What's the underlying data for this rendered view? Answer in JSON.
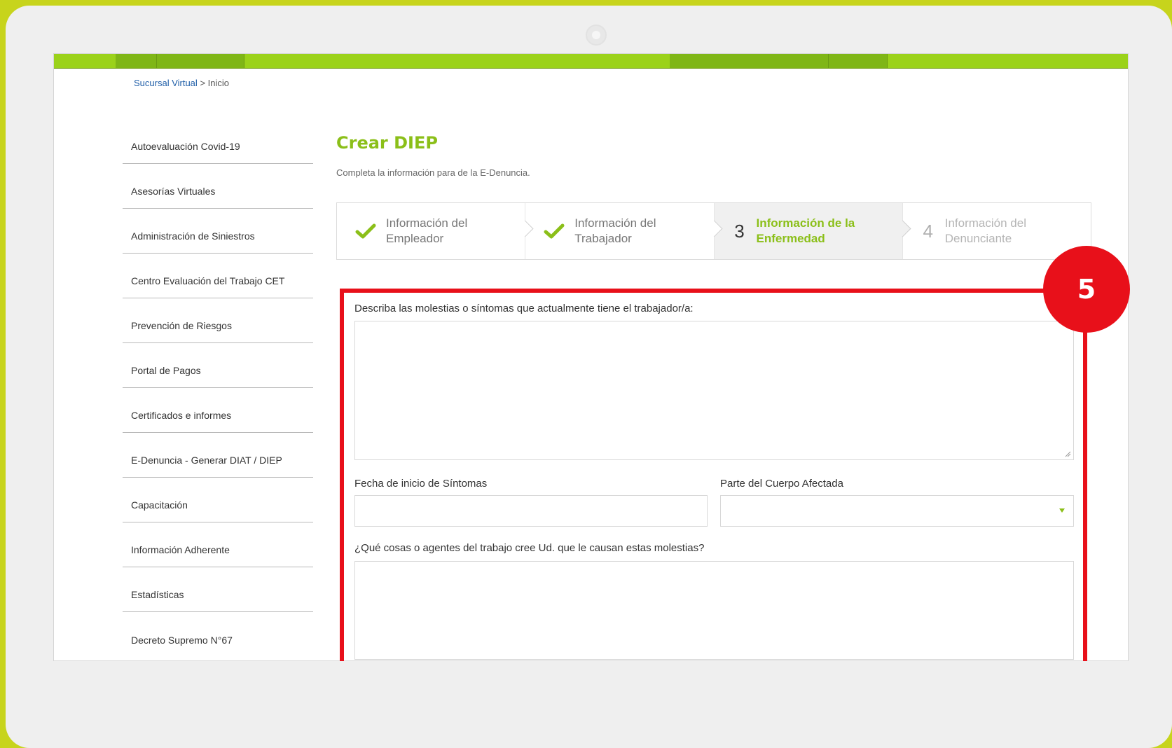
{
  "breadcrumb": {
    "home": "Sucursal Virtual",
    "separator": ">",
    "current": "Inicio"
  },
  "sidebar": {
    "items": [
      {
        "label": "Autoevaluación Covid-19"
      },
      {
        "label": "Asesorías Virtuales"
      },
      {
        "label": "Administración de Siniestros"
      },
      {
        "label": "Centro Evaluación del Trabajo CET"
      },
      {
        "label": "Prevención de Riesgos"
      },
      {
        "label": "Portal de Pagos"
      },
      {
        "label": "Certificados e informes"
      },
      {
        "label": "E-Denuncia - Generar DIAT / DIEP"
      },
      {
        "label": "Capacitación"
      },
      {
        "label": "Información Adherente"
      },
      {
        "label": "Estadísticas"
      },
      {
        "label": "Decreto Supremo N°67"
      }
    ]
  },
  "main": {
    "title": "Crear DIEP",
    "subtitle": "Completa la información para de la E-Denuncia.",
    "steps": [
      {
        "line1": "Información del",
        "line2": "Empleador",
        "status": "done"
      },
      {
        "line1": "Información del",
        "line2": "Trabajador",
        "status": "done"
      },
      {
        "number": "3",
        "line1": "Información de la",
        "line2": "Enfermedad",
        "status": "active"
      },
      {
        "number": "4",
        "line1": "Información del",
        "line2": "Denunciante",
        "status": "pending"
      }
    ]
  },
  "form": {
    "symptoms_label": "Describa las molestias o síntomas que actualmente tiene el trabajador/a:",
    "symptoms_value": "",
    "start_date_label": "Fecha de inicio de Síntomas",
    "start_date_value": "",
    "body_part_label": "Parte del Cuerpo Afectada",
    "body_part_value": "",
    "agents_label": "¿Qué cosas o agentes del trabajo cree Ud. que le causan estas molestias?",
    "agents_value": ""
  },
  "annotation": {
    "badge": "5",
    "color": "#e8101a"
  },
  "colors": {
    "accent": "#8bbf19",
    "frame": "#c7d41c",
    "nav": "#9bd21a"
  }
}
